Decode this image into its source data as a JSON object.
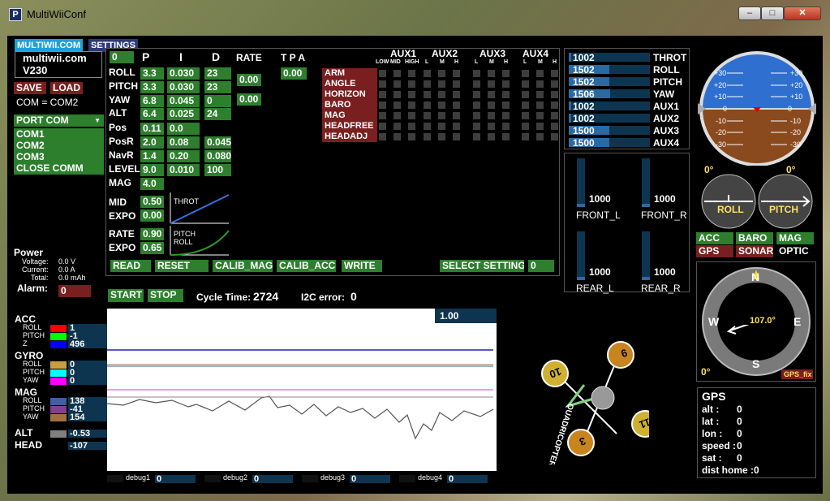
{
  "window": {
    "title": "MultiWiiConf",
    "app_icon": "P"
  },
  "tabs": [
    {
      "label": "MULTIWII.COM"
    },
    {
      "label": "SETTINGS"
    }
  ],
  "header": {
    "site": "multiwii.com",
    "version": "V230"
  },
  "buttons": {
    "save": "SAVE",
    "load": "LOAD",
    "read": "READ",
    "reset": "RESET",
    "calib_mag": "CALIB_MAG",
    "calib_acc": "CALIB_ACC",
    "write": "WRITE",
    "select_setting": "SELECT SETTING",
    "select_setting_value": "0",
    "start": "START",
    "stop": "STOP"
  },
  "com": {
    "status": "COM = COM2",
    "port_label": "PORT COM",
    "ports": [
      "COM1",
      "COM2",
      "COM3"
    ],
    "close": "CLOSE COMM"
  },
  "power": {
    "title": "Power",
    "voltage_label": "Voltage:",
    "voltage": "0.0 V",
    "current_label": "Current:",
    "current": "0.0 A",
    "total_label": "Total:",
    "total": "0.0 mAh",
    "alarm_label": "Alarm:",
    "alarm": "0"
  },
  "pid": {
    "index": "0",
    "headers": {
      "p": "P",
      "i": "I",
      "d": "D",
      "rate": "RATE",
      "tpa": "T P A"
    },
    "tpa_value": "0.00",
    "rows": [
      {
        "name": "ROLL",
        "p": "3.3",
        "i": "0.030",
        "d": "23"
      },
      {
        "name": "PITCH",
        "p": "3.3",
        "i": "0.030",
        "d": "23"
      },
      {
        "name": "YAW",
        "p": "6.8",
        "i": "0.045",
        "d": "0"
      },
      {
        "name": "ALT",
        "p": "6.4",
        "i": "0.025",
        "d": "24"
      },
      {
        "name": "Pos",
        "p": "0.11",
        "i": "0.0",
        "d": ""
      },
      {
        "name": "PosR",
        "p": "2.0",
        "i": "0.08",
        "d": "0.045"
      },
      {
        "name": "NavR",
        "p": "1.4",
        "i": "0.20",
        "d": "0.080"
      },
      {
        "name": "LEVEL",
        "p": "9.0",
        "i": "0.010",
        "d": "100"
      },
      {
        "name": "MAG",
        "p": "4.0",
        "i": "",
        "d": ""
      }
    ],
    "rate_rollpitch": "0.00",
    "rate_yaw": "0.00",
    "mid_label": "MID",
    "mid": "0.50",
    "expo_label": "EXPO",
    "expo": "0.00",
    "throt_curve_label": "THROT",
    "rate_label": "RATE",
    "rate2": "0.90",
    "expo2_label": "EXPO",
    "expo2": "0.65",
    "pitchroll_curve_label_1": "PITCH",
    "pitchroll_curve_label_2": "ROLL"
  },
  "aux": {
    "groups": [
      "AUX1",
      "AUX2",
      "AUX3",
      "AUX4"
    ],
    "levels": [
      "LOW",
      "MID",
      "HIGH",
      "L",
      "M",
      "H",
      "L",
      "M",
      "H",
      "L",
      "M",
      "H"
    ],
    "modes": [
      "ARM",
      "ANGLE",
      "HORIZON",
      "BARO",
      "MAG",
      "HEADFREE",
      "HEADADJ"
    ]
  },
  "rc": [
    {
      "name": "THROT",
      "value": "1002",
      "fill": 0.002
    },
    {
      "name": "ROLL",
      "value": "1502",
      "fill": 0.5
    },
    {
      "name": "PITCH",
      "value": "1502",
      "fill": 0.5
    },
    {
      "name": "YAW",
      "value": "1506",
      "fill": 0.51
    },
    {
      "name": "AUX1",
      "value": "1002",
      "fill": 0.002
    },
    {
      "name": "AUX2",
      "value": "1002",
      "fill": 0.002
    },
    {
      "name": "AUX3",
      "value": "1500",
      "fill": 0.5
    },
    {
      "name": "AUX4",
      "value": "1500",
      "fill": 0.5
    }
  ],
  "motors": [
    {
      "name": "FRONT_L",
      "value": "1000",
      "fill": 0.0
    },
    {
      "name": "FRONT_R",
      "value": "1000",
      "fill": 0.0
    },
    {
      "name": "REAR_L",
      "value": "1000",
      "fill": 0.0
    },
    {
      "name": "REAR_R",
      "value": "1000",
      "fill": 0.0
    }
  ],
  "horizon": {
    "ticks": [
      "+30",
      "+20",
      "+10",
      "0",
      "-10",
      "-20",
      "-30"
    ],
    "roll": "0°",
    "pitch": "0°",
    "roll_label": "ROLL",
    "pitch_label": "PITCH",
    "sky_color": "#2f6fd0",
    "ground_color": "#8a4a1e"
  },
  "sensors_status": [
    {
      "name": "ACC",
      "state": "on"
    },
    {
      "name": "BARO",
      "state": "on"
    },
    {
      "name": "MAG",
      "state": "on"
    },
    {
      "name": "GPS",
      "state": "off"
    },
    {
      "name": "SONAR",
      "state": "off"
    },
    {
      "name": "OPTIC",
      "state": "none"
    }
  ],
  "compass": {
    "n": "N",
    "e": "E",
    "s": "S",
    "w": "W",
    "heading": "107.0°",
    "alt_angle": "0°",
    "gps_fix": "GPS_fix"
  },
  "gps": {
    "title": "GPS",
    "fields": [
      {
        "label": "alt",
        "value": "0"
      },
      {
        "label": "lat",
        "value": "0"
      },
      {
        "label": "lon",
        "value": "0"
      },
      {
        "label": "speed",
        "value": "0"
      },
      {
        "label": "sat",
        "value": "0"
      },
      {
        "label": "dist home",
        "value": "0"
      }
    ]
  },
  "sensors": {
    "acc_title": "ACC",
    "gyro_title": "GYRO",
    "mag_title": "MAG",
    "alt_title": "ALT",
    "head_title": "HEAD",
    "acc": [
      {
        "axis": "ROLL",
        "value": "1",
        "color": "#ff0000"
      },
      {
        "axis": "PITCH",
        "value": "-1",
        "color": "#00ff00"
      },
      {
        "axis": "Z",
        "value": "496",
        "color": "#0000ff"
      }
    ],
    "gyro": [
      {
        "axis": "ROLL",
        "value": "0",
        "color": "#c8a040"
      },
      {
        "axis": "PITCH",
        "value": "0",
        "color": "#00ffff"
      },
      {
        "axis": "YAW",
        "value": "0",
        "color": "#ff00ff"
      }
    ],
    "mag": [
      {
        "axis": "ROLL",
        "value": "138",
        "color": "#4060a0"
      },
      {
        "axis": "PITCH",
        "value": "-41",
        "color": "#804090"
      },
      {
        "axis": "YAW",
        "value": "154",
        "color": "#a07040"
      }
    ],
    "alt": {
      "value": "-0.53",
      "color": "#808080"
    },
    "head": {
      "value": "-107",
      "color": "#000000"
    }
  },
  "status": {
    "cycle_label": "Cycle Time:",
    "cycle": "2724",
    "i2c_label": "I2C error:",
    "i2c": "0"
  },
  "graph": {
    "scale": "1.00"
  },
  "debug": [
    {
      "name": "debug1",
      "value": "0"
    },
    {
      "name": "debug2",
      "value": "0"
    },
    {
      "name": "debug3",
      "value": "0"
    },
    {
      "name": "debug4",
      "value": "0"
    }
  ],
  "quad": {
    "label": "QUADRICOPTER X",
    "motors": [
      "9",
      "10",
      "11",
      "3"
    ]
  }
}
